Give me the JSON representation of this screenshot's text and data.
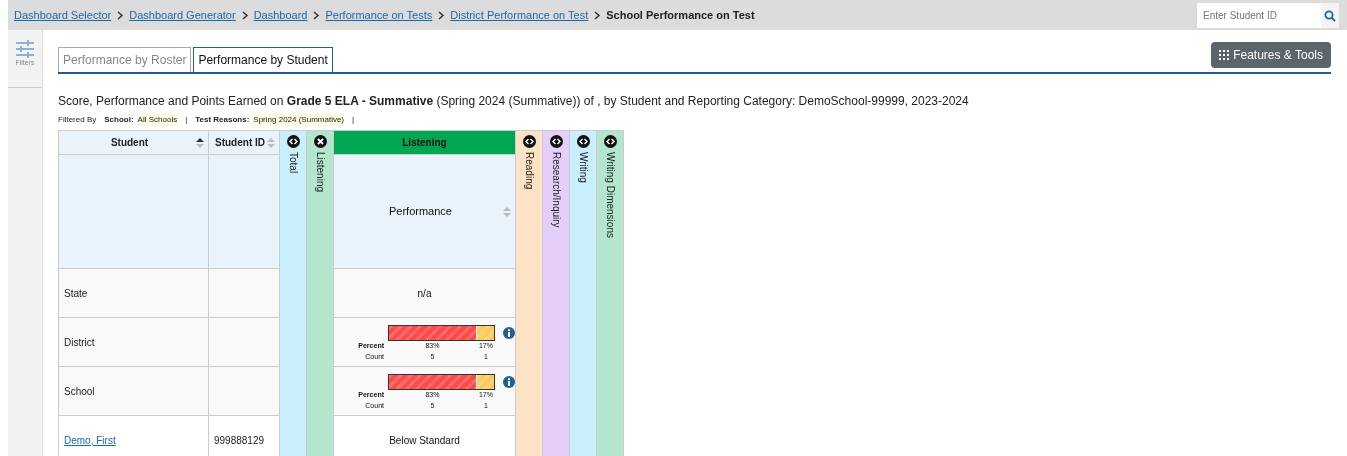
{
  "breadcrumbs": [
    {
      "label": "Dashboard Selector",
      "link": true
    },
    {
      "label": "Dashboard Generator",
      "link": true
    },
    {
      "label": "Dashboard",
      "link": true
    },
    {
      "label": "Performance on Tests",
      "link": true
    },
    {
      "label": "District Performance on Test",
      "link": true
    },
    {
      "label": "School Performance on Test",
      "link": false
    }
  ],
  "search": {
    "placeholder": "Enter Student ID"
  },
  "sidebar": {
    "label": "Filters"
  },
  "tabs": [
    {
      "label": "Performance by Roster",
      "selected": false
    },
    {
      "label": "Performance by Student",
      "selected": true
    }
  ],
  "features_button": "Features & Tools",
  "title": "Score, Performance and Points Earned on **Grade 5 ELA - Summative** (Spring 2024 (Summative)) of , by Student and Reporting Category: DemoSchool-99999, 2023-2024",
  "filters": {
    "label": "Filtered By",
    "divider": "|",
    "items": [
      {
        "name": "School:",
        "value": "All Schools"
      },
      {
        "name": "Test Reasons:",
        "value": "Spring 2024 (Summative)"
      }
    ]
  },
  "table": {
    "columns": [
      {
        "label": "Student",
        "sorted": true
      },
      {
        "label": "Student ID",
        "sorted": false
      }
    ],
    "groups": [
      {
        "label": "Total",
        "color": "#c9eefc",
        "expanded": false
      },
      {
        "label": "Listening",
        "color": "#b3e6cc",
        "expanded": true,
        "header": {
          "label": "Listening",
          "color": "#00a651"
        },
        "sub_label": "Performance"
      },
      {
        "label": "Reading",
        "color": "#fde3c5",
        "expanded": false
      },
      {
        "label": "Research/Inquiry",
        "color": "#e3cffa",
        "expanded": false
      },
      {
        "label": "Writing",
        "color": "#c9eefc",
        "expanded": false
      },
      {
        "label": "Writing Dimensions",
        "color": "#b3e6cc",
        "expanded": false
      }
    ],
    "rows": [
      {
        "kind": "aggregate",
        "name": "State",
        "performance": {
          "kind": "text",
          "text": "n/a"
        }
      },
      {
        "kind": "aggregate",
        "name": "District",
        "performance": {
          "kind": "bar",
          "percent_label": "Percent",
          "count_label": "Count",
          "segments": [
            {
              "level": 0.83,
              "percent": "83%",
              "count": "5",
              "color": "#ff4a4a"
            },
            {
              "level": 0.17,
              "percent": "17%",
              "count": "1",
              "color": "#fdc95a"
            }
          ]
        }
      },
      {
        "kind": "aggregate",
        "name": "School",
        "performance": {
          "kind": "bar",
          "percent_label": "Percent",
          "count_label": "Count",
          "segments": [
            {
              "level": 0.83,
              "percent": "83%",
              "count": "5",
              "color": "#ff4a4a"
            },
            {
              "level": 0.17,
              "percent": "17%",
              "count": "1",
              "color": "#fdc95a"
            }
          ]
        }
      },
      {
        "kind": "student",
        "name": "Demo, First",
        "student_id": "999888129",
        "performance": {
          "kind": "text",
          "text": "Below Standard"
        }
      }
    ]
  }
}
